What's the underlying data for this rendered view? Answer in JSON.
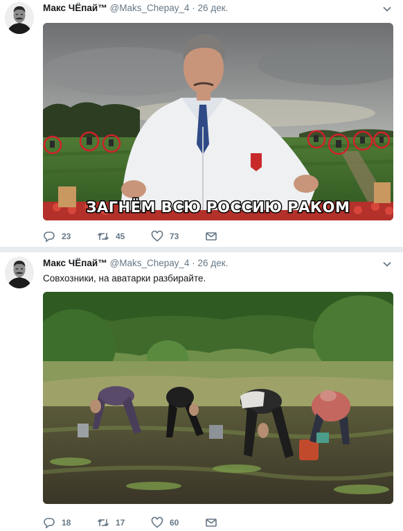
{
  "tweets": [
    {
      "author": "Макс ЧЁпай™",
      "handle": "@Maks_Chepay_4",
      "separator": "·",
      "date": "26 дек.",
      "text": "",
      "image_caption": "ЗАГНЁМ ВСЮ РОССИЮ РАКОМ",
      "replies": "23",
      "retweets": "45",
      "likes": "73"
    },
    {
      "author": "Макс ЧЁпай™",
      "handle": "@Maks_Chepay_4",
      "separator": "·",
      "date": "26 дек.",
      "text": "Совхозники, на аватарки разбирайте.",
      "replies": "18",
      "retweets": "17",
      "likes": "60"
    }
  ],
  "icons": {
    "reply": "reply-icon",
    "retweet": "retweet-icon",
    "like": "heart-icon",
    "message": "envelope-icon",
    "menu": "chevron-down-icon"
  },
  "colors": {
    "secondary_text": "#657786",
    "primary_text": "#14171a",
    "background": "#e6ecf0",
    "circle_marks": "#d0212a"
  }
}
